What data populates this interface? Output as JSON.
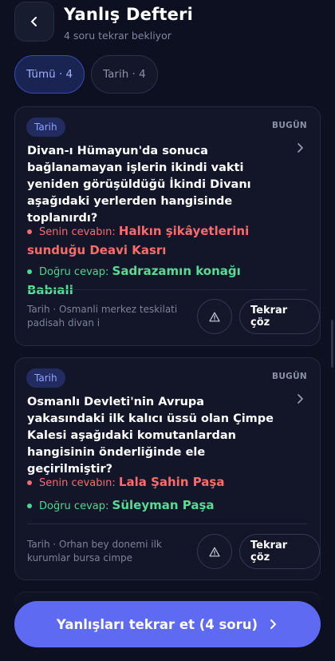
{
  "header": {
    "back_icon": "chevron-left-icon",
    "title": "Yanlış Defteri",
    "subtitle": "4 soru tekrar bekliyor"
  },
  "filters": [
    {
      "label": "Tümü · 4",
      "active": true
    },
    {
      "label": "Tarih · 4",
      "active": false
    }
  ],
  "cards": [
    {
      "tag": "Tarih",
      "date": "BUGÜN",
      "question": "Divan-ı Hümayun'da sonuca bağlanamayan işlerin ikindi vakti yeniden görüşüldüğü İkindi Divanı aşağıdaki yerlerden hangisinde toplanırdı?",
      "your_answer_label": "Senin cevabın:",
      "your_answer": "Halkın şikâyetlerini sunduğu Deavi Kasrı",
      "correct_answer_label": "Doğru cevap:",
      "correct_answer": "Sadrazamın konağı Babıali",
      "meta": "Tarih · Osmanli merkez teskilati padisah divan i",
      "retry_label": "Tekrar çöz"
    },
    {
      "tag": "Tarih",
      "date": "BUGÜN",
      "question": "Osmanlı Devleti'nin Avrupa yakasındaki ilk kalıcı üssü olan Çimpe Kalesi aşağıdaki komutanlardan hangisinin önderliğinde ele geçirilmiştir?",
      "your_answer_label": "Senin cevabın:",
      "your_answer": "Lala Şahin Paşa",
      "correct_answer_label": "Doğru cevap:",
      "correct_answer": "Süleyman Paşa",
      "meta": "Tarih · Orhan bey donemi ilk kurumlar bursa cimpe",
      "retry_label": "Tekrar çöz"
    }
  ],
  "cta": {
    "label": "Yanlışları tekrar et (4 soru)",
    "icon": "chevron-right-icon"
  },
  "colors": {
    "background": "#0d1020",
    "accent": "#5f6af2",
    "wrong": "#ff6b6b",
    "correct": "#58dc94"
  }
}
